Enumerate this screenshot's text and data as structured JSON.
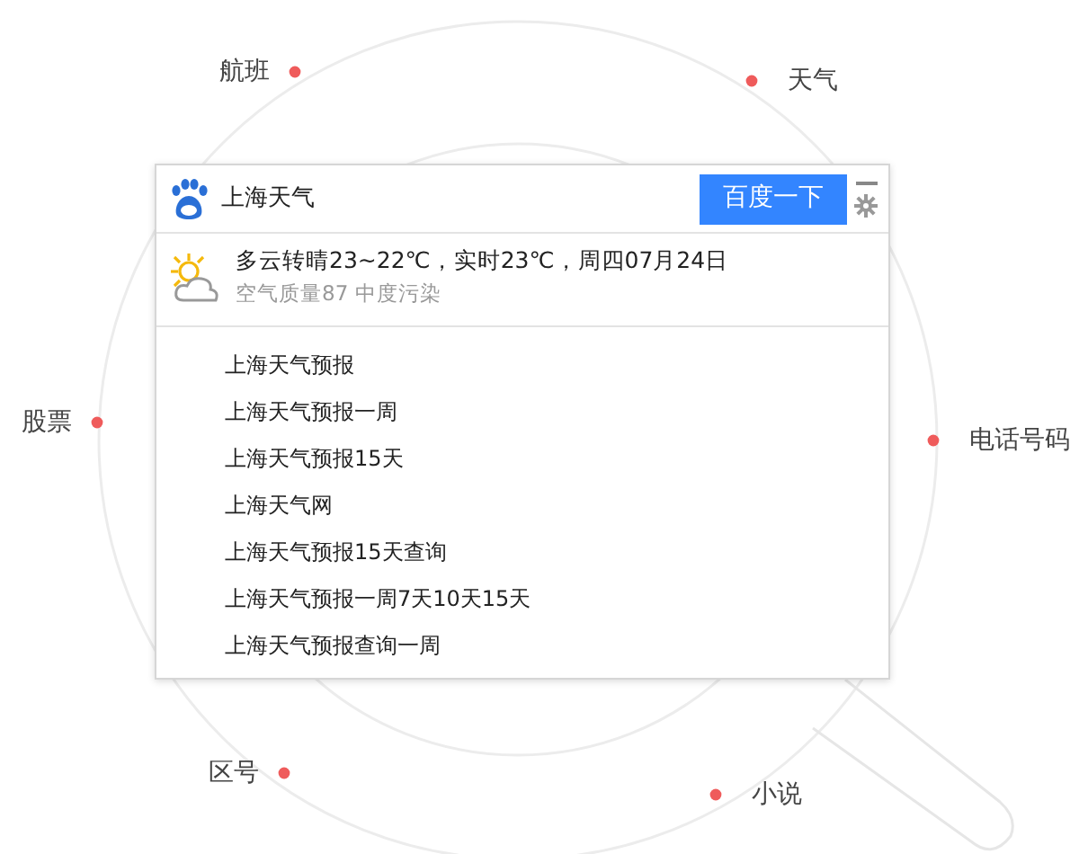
{
  "orbit_labels": [
    "航班",
    "天气",
    "股票",
    "电话号码",
    "区号",
    "小说"
  ],
  "search": {
    "value": "上海天气",
    "button": "百度一下"
  },
  "weather": {
    "summary": "多云转晴23~22℃，实时23℃，周四07月24日",
    "air_quality": "空气质量87 中度污染"
  },
  "suggestions": [
    "上海天气预报",
    "上海天气预报一周",
    "上海天气预报15天",
    "上海天气网",
    "上海天气预报15天查询",
    "上海天气预报一周7天10天15天",
    "上海天气预报查询一周"
  ]
}
